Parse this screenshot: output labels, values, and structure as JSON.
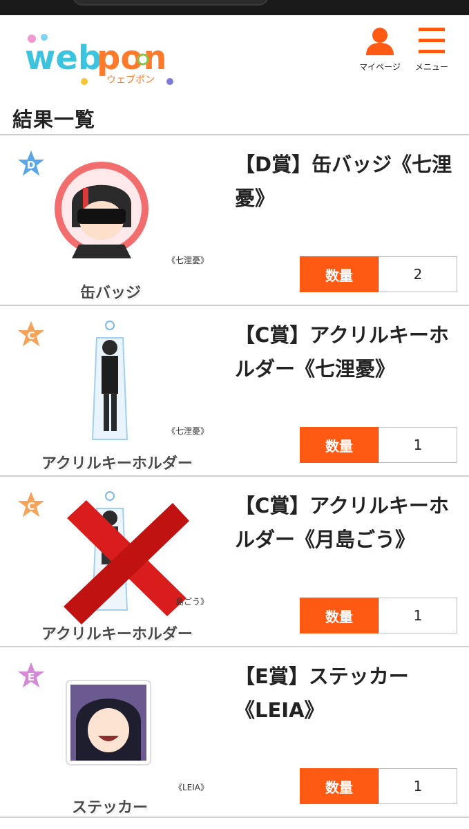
{
  "header": {
    "logo_text": "webpon",
    "logo_sub": "ウェブポン",
    "mypage_label": "マイページ",
    "menu_label": "メニュー"
  },
  "section_title": "結果一覧",
  "colors": {
    "accent": "#ff5a14",
    "divider": "#d0d0d0"
  },
  "items": [
    {
      "grade": "D",
      "badge_color": "#5aa6e8",
      "name": "【D賞】缶バッジ《七浬憂》",
      "product_caption": "缶バッジ",
      "character_caption": "《七浬憂》",
      "qty_label": "数量",
      "qty": "2",
      "image": "can-badge-image",
      "crossed_out": false
    },
    {
      "grade": "C",
      "badge_color": "#f4a35a",
      "name": "【C賞】アクリルキーホルダー《七浬憂》",
      "product_caption": "アクリルキーホルダー",
      "character_caption": "《七浬憂》",
      "qty_label": "数量",
      "qty": "1",
      "image": "acrylic-keychain-image",
      "crossed_out": false
    },
    {
      "grade": "C",
      "badge_color": "#f4a35a",
      "name": "【C賞】アクリルキーホルダー《月島ごう》",
      "product_caption": "アクリルキーホルダー",
      "character_caption": "島ごう》",
      "qty_label": "数量",
      "qty": "1",
      "image": "acrylic-keychain-image",
      "crossed_out": true
    },
    {
      "grade": "E",
      "badge_color": "#d58ad8",
      "name": "【E賞】ステッカー《LEIA》",
      "product_caption": "ステッカー",
      "character_caption": "《LEIA》",
      "qty_label": "数量",
      "qty": "1",
      "image": "sticker-image",
      "crossed_out": false
    }
  ]
}
